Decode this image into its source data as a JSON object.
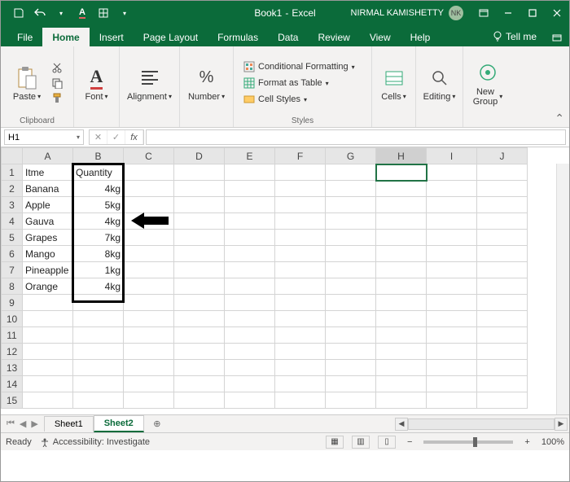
{
  "title": {
    "doc": "Book1",
    "app": "Excel"
  },
  "user": {
    "name": "NIRMAL KAMISHETTY",
    "initials": "NK"
  },
  "tabs": {
    "file": "File",
    "home": "Home",
    "insert": "Insert",
    "pagelayout": "Page Layout",
    "formulas": "Formulas",
    "data": "Data",
    "review": "Review",
    "view": "View",
    "help": "Help",
    "tellme": "Tell me"
  },
  "ribbon": {
    "paste": "Paste",
    "clipboard": "Clipboard",
    "font": "Font",
    "alignment": "Alignment",
    "number": "Number",
    "cond": "Conditional Formatting",
    "fmt": "Format as Table",
    "styles": "Cell Styles",
    "styles_grp": "Styles",
    "cells": "Cells",
    "editing": "Editing",
    "newgroup": "New\nGroup"
  },
  "namebox": "H1",
  "columns": [
    "A",
    "B",
    "C",
    "D",
    "E",
    "F",
    "G",
    "H",
    "I",
    "J"
  ],
  "rows": [
    "1",
    "2",
    "3",
    "4",
    "5",
    "6",
    "7",
    "8",
    "9",
    "10",
    "11",
    "12",
    "13",
    "14",
    "15"
  ],
  "cells": {
    "A1": "Itme",
    "B1": "Quantity",
    "A2": "Banana",
    "B2": "4kg",
    "A3": "Apple",
    "B3": "5kg",
    "A4": "Gauva",
    "B4": "4kg",
    "A5": "Grapes",
    "B5": "7kg",
    "A6": "Mango",
    "B6": "8kg",
    "A7": "Pineapple",
    "B7": "1kg",
    "A8": "Orange",
    "B8": "4kg"
  },
  "right_aligned_cells": [
    "B2",
    "B3",
    "B4",
    "B5",
    "B6",
    "B7",
    "B8"
  ],
  "selected_cell": "H1",
  "highlighted_column": "H",
  "sheets": {
    "s1": "Sheet1",
    "s2": "Sheet2",
    "active": "s2"
  },
  "status": {
    "ready": "Ready",
    "acc": "Accessibility: Investigate",
    "zoom": "100%"
  }
}
